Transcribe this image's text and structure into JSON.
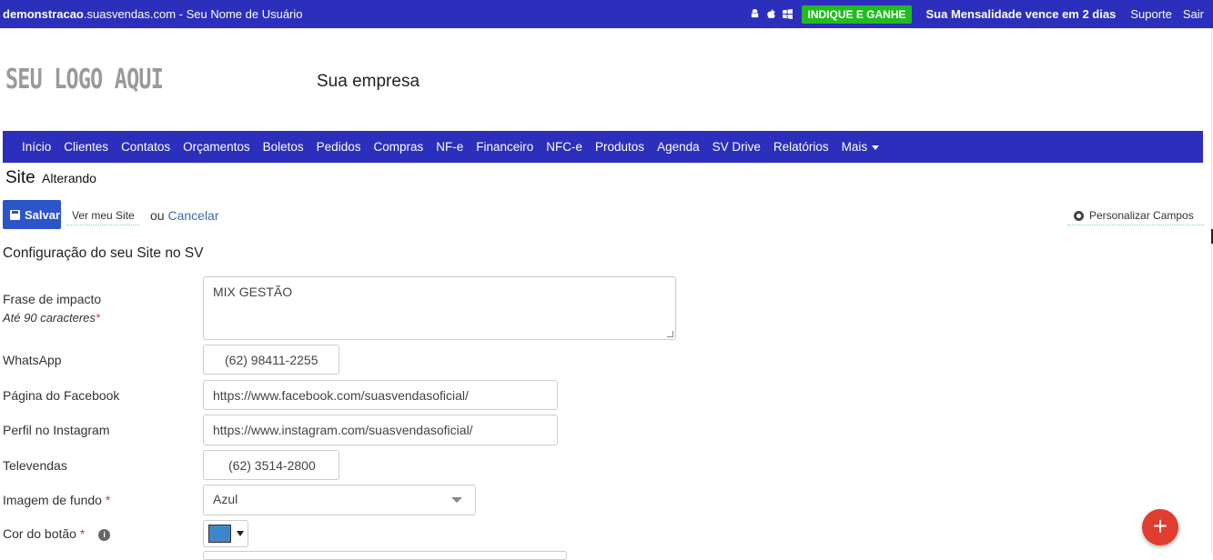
{
  "topbar": {
    "domain_bold": "demonstracao",
    "domain_rest": ".suasvendas.com",
    "separator": " - ",
    "username": "Seu Nome de Usuário",
    "indique": "INDIQUE E GANHE",
    "mensalidade": "Sua Mensalidade vence em 2 dias",
    "suporte": "Suporte",
    "sair": "Sair",
    "icons": [
      "android-icon",
      "apple-icon",
      "windows-icon"
    ]
  },
  "header": {
    "logo": "SEU LOGO AQUI",
    "company": "Sua empresa"
  },
  "nav": {
    "items": [
      "Início",
      "Clientes",
      "Contatos",
      "Orçamentos",
      "Boletos",
      "Pedidos",
      "Compras",
      "NF-e",
      "Financeiro",
      "NFC-e",
      "Produtos",
      "Agenda",
      "SV Drive",
      "Relatórios"
    ],
    "more": "Mais"
  },
  "page": {
    "title": "Site",
    "subtitle": "Alterando"
  },
  "actions": {
    "save": "Salvar",
    "view_site": "Ver meu Site",
    "or": "ou",
    "cancel": "Cancelar",
    "customize": "Personalizar Campos"
  },
  "form": {
    "section_title": "Configuração do seu Site no SV",
    "frase_label": "Frase de impacto",
    "frase_hint": "Até 90 caracteres",
    "frase_value": "MIX GESTÃO",
    "whatsapp_label": "WhatsApp",
    "whatsapp_value": "(62) 98411-2255",
    "facebook_label": "Página do Facebook",
    "facebook_value": "https://www.facebook.com/suasvendasoficial/",
    "instagram_label": "Perfil no Instagram",
    "instagram_value": "https://www.instagram.com/suasvendasoficial/",
    "televendas_label": "Televendas",
    "televendas_value": "(62) 3514-2800",
    "imagem_label": "Imagem de fundo",
    "imagem_value": "Azul",
    "cor_label": "Cor do botão",
    "cor_value": "#3d86cc",
    "required_mark": "*"
  },
  "colors": {
    "primary": "#2b2fbb",
    "success": "#22bb22",
    "danger": "#e03c2f",
    "link": "#3a6fb0"
  },
  "fab": {
    "symbol": "+"
  }
}
